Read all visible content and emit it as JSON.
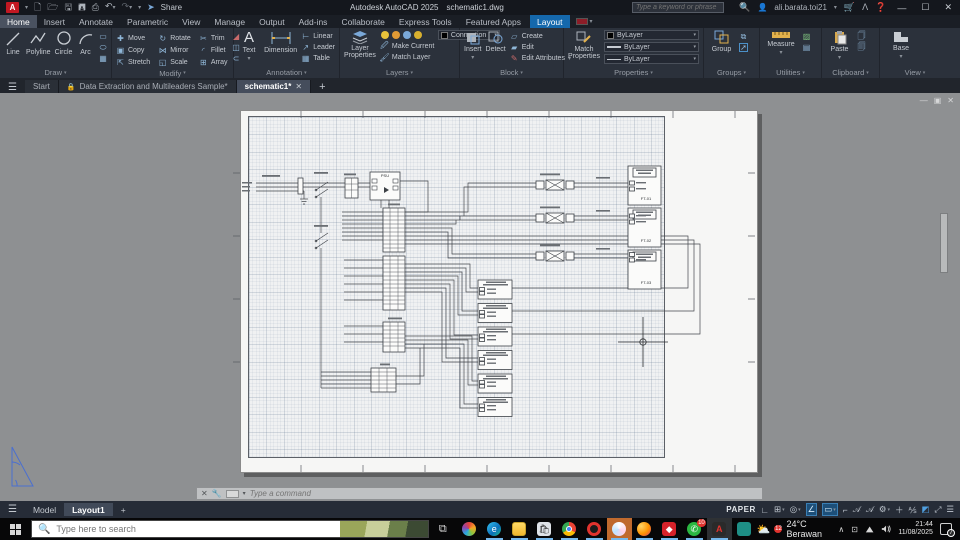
{
  "title_bar": {
    "app": "Autodesk AutoCAD 2025",
    "doc": "schematic1.dwg",
    "share": "Share",
    "search_placeholder": "Type a keyword or phrase",
    "user": "ali.barata.toi21"
  },
  "ribbon": {
    "tabs": [
      {
        "label": "Home"
      },
      {
        "label": "Insert"
      },
      {
        "label": "Annotate"
      },
      {
        "label": "Parametric"
      },
      {
        "label": "View"
      },
      {
        "label": "Manage"
      },
      {
        "label": "Output"
      },
      {
        "label": "Add-ins"
      },
      {
        "label": "Collaborate"
      },
      {
        "label": "Express Tools"
      },
      {
        "label": "Featured Apps"
      },
      {
        "label": "Layout"
      }
    ],
    "draw": {
      "label": "Draw",
      "items": [
        "Line",
        "Polyline",
        "Circle",
        "Arc"
      ]
    },
    "modify": {
      "label": "Modify",
      "items": [
        "Move",
        "Rotate",
        "Trim",
        "Copy",
        "Mirror",
        "Fillet",
        "Stretch",
        "Scale",
        "Array"
      ]
    },
    "annotation": {
      "label": "Annotation",
      "big": [
        "Text",
        "Dimension"
      ],
      "small": [
        "Linear",
        "Leader",
        "Table"
      ]
    },
    "layers": {
      "label": "Layers",
      "big": "Layer Properties",
      "dropdown": "Connection",
      "small": [
        "Make Current",
        "Match Layer"
      ]
    },
    "block": {
      "label": "Block",
      "big": [
        "Insert",
        "Detect"
      ],
      "small": [
        "Create",
        "Edit",
        "Edit Attributes"
      ]
    },
    "properties": {
      "label": "Properties",
      "big": "Match Properties",
      "rows": [
        "ByLayer",
        "ByLayer",
        "ByLayer"
      ]
    },
    "groups": {
      "label": "Groups",
      "big": "Group"
    },
    "utilities": {
      "label": "Utilities",
      "big": "Measure"
    },
    "clipboard": {
      "label": "Clipboard",
      "big": "Paste"
    },
    "view": {
      "label": "View",
      "big": "Base"
    }
  },
  "file_tabs": {
    "start": "Start",
    "tab2": "Data Extraction and Multileaders Sample*",
    "tab3": "schematic1*"
  },
  "drawing": {
    "psu": "PSU",
    "ft": [
      "FT-01",
      "FT-02",
      "FT-03"
    ]
  },
  "command_line": {
    "placeholder": "Type a command"
  },
  "status_bar": {
    "model": "Model",
    "layout": "Layout1",
    "paper": "PAPER"
  },
  "taskbar": {
    "search_placeholder": "Type here to search",
    "weather": "24°C Berawan",
    "weather_badge": "12",
    "whatsapp_badge": "10",
    "time": "21:44",
    "date": "11/08/2025",
    "notification_badge": "7"
  }
}
